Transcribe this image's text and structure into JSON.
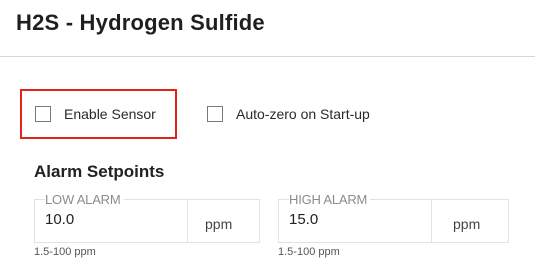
{
  "header": {
    "title": "H2S - Hydrogen Sulfide"
  },
  "options": {
    "enable_sensor": {
      "label": "Enable Sensor",
      "checked": false
    },
    "auto_zero": {
      "label": "Auto-zero on Start-up",
      "checked": false
    }
  },
  "alarm": {
    "section_title": "Alarm Setpoints",
    "low": {
      "label": "LOW ALARM",
      "value": "10.0",
      "unit": "ppm",
      "range": "1.5-100 ppm"
    },
    "high": {
      "label": "HIGH ALARM",
      "value": "15.0",
      "unit": "ppm",
      "range": "1.5-100 ppm"
    }
  },
  "colors": {
    "highlight": "#e2231a",
    "divider": "#d6d6d6",
    "field_border": "#e2e2e2"
  }
}
